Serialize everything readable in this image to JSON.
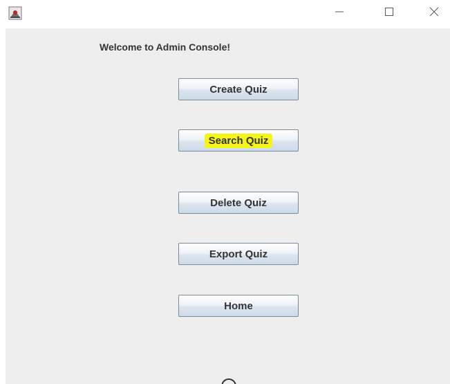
{
  "window": {
    "app_icon": "java-cup-icon",
    "controls": {
      "minimize_icon": "minimize-icon",
      "maximize_icon": "maximize-icon",
      "close_icon": "close-icon"
    }
  },
  "content": {
    "welcome_text": "Welcome to Admin Console!",
    "buttons": [
      {
        "label": "Create Quiz",
        "highlighted": false
      },
      {
        "label": "Search Quiz",
        "highlighted": true,
        "highlight_color": "#f4f41a"
      },
      {
        "label": "Delete Quiz",
        "highlighted": false
      },
      {
        "label": "Export Quiz",
        "highlighted": false
      },
      {
        "label": "Home",
        "highlighted": false
      }
    ]
  },
  "colors": {
    "panel_background": "#eeeeee",
    "button_border": "#7a8a99",
    "text": "#333333"
  }
}
